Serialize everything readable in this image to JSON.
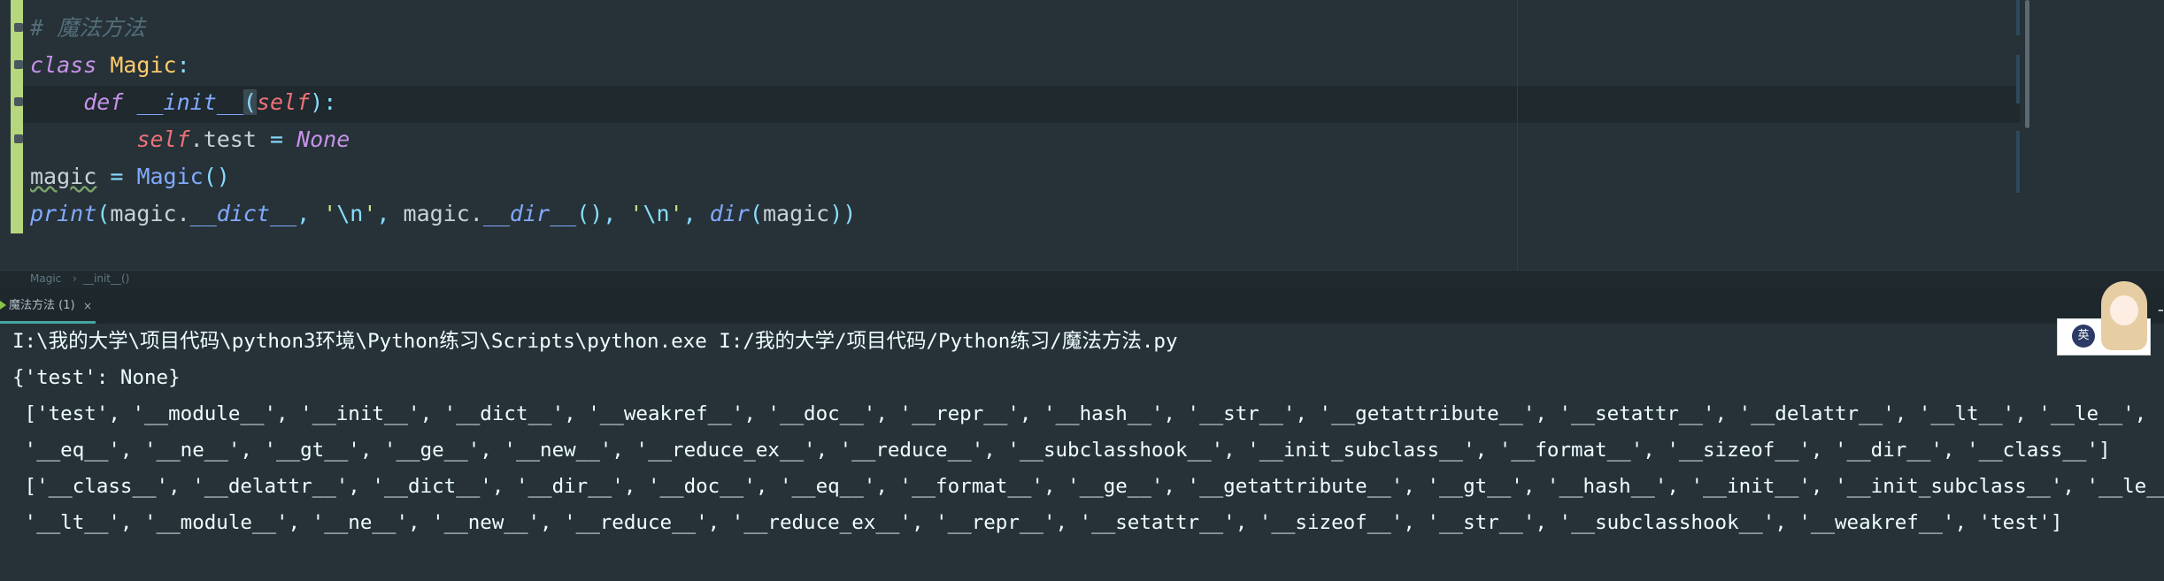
{
  "editor": {
    "lines": [
      {
        "tokens": [
          [
            "t-comment",
            "# 魔法方法"
          ]
        ]
      },
      {
        "tokens": [
          [
            "t-kw",
            "class"
          ],
          [
            "t-plain",
            " "
          ],
          [
            "t-cls",
            "Magic"
          ],
          [
            "t-punc",
            ":"
          ]
        ]
      },
      {
        "tokens": [
          [
            "t-plain",
            "    "
          ],
          [
            "t-kw",
            "def"
          ],
          [
            "t-plain",
            " "
          ],
          [
            "t-fn",
            "__init__"
          ],
          [
            "t-punc t-brace-hl",
            "("
          ],
          [
            "t-self",
            "self"
          ],
          [
            "t-punc",
            "):"
          ]
        ]
      },
      {
        "tokens": [
          [
            "t-plain",
            "        "
          ],
          [
            "t-self",
            "self"
          ],
          [
            "t-plain",
            ".test "
          ],
          [
            "t-op",
            "="
          ],
          [
            "t-plain",
            " "
          ],
          [
            "t-const",
            "None"
          ]
        ]
      },
      {
        "tokens": [
          [
            "t-plain t-underline",
            "magic"
          ],
          [
            "t-plain",
            " "
          ],
          [
            "t-op",
            "="
          ],
          [
            "t-plain",
            " "
          ],
          [
            "t-call",
            "Magic"
          ],
          [
            "t-punc",
            "()"
          ]
        ]
      },
      {
        "tokens": [
          [
            "t-fn",
            "print"
          ],
          [
            "t-punc",
            "("
          ],
          [
            "t-plain",
            "magic."
          ],
          [
            "t-fn",
            "__dict__"
          ],
          [
            "t-punc",
            ", "
          ],
          [
            "t-str",
            "'"
          ],
          [
            "t-esc",
            "\\n"
          ],
          [
            "t-str",
            "'"
          ],
          [
            "t-punc",
            ", "
          ],
          [
            "t-plain",
            "magic."
          ],
          [
            "t-fn",
            "__dir__"
          ],
          [
            "t-punc",
            "(), "
          ],
          [
            "t-str",
            "'"
          ],
          [
            "t-esc",
            "\\n"
          ],
          [
            "t-str",
            "'"
          ],
          [
            "t-punc",
            ", "
          ],
          [
            "t-fn",
            "dir"
          ],
          [
            "t-punc",
            "("
          ],
          [
            "t-plain",
            "magic"
          ],
          [
            "t-punc",
            "))"
          ]
        ]
      }
    ]
  },
  "breadcrumb": {
    "items": [
      "Magic",
      "›",
      "__init__()"
    ]
  },
  "run_panel": {
    "tab_label": "魔法方法 (1)",
    "close_glyph": "×",
    "edge_glyph": "-"
  },
  "console": {
    "lines": [
      "I:\\我的大学\\项目代码\\python3环境\\Python练习\\Scripts\\python.exe I:/我的大学/项目代码/Python练习/魔法方法.py",
      "{'test': None}",
      " ['test', '__module__', '__init__', '__dict__', '__weakref__', '__doc__', '__repr__', '__hash__', '__str__', '__getattribute__', '__setattr__', '__delattr__', '__lt__', '__le__',",
      " '__eq__', '__ne__', '__gt__', '__ge__', '__new__', '__reduce_ex__', '__reduce__', '__subclasshook__', '__init_subclass__', '__format__', '__sizeof__', '__dir__', '__class__']",
      " ['__class__', '__delattr__', '__dict__', '__dir__', '__doc__', '__eq__', '__format__', '__ge__', '__getattribute__', '__gt__', '__hash__', '__init__', '__init_subclass__', '__le__',",
      " '__lt__', '__module__', '__ne__', '__new__', '__reduce__', '__reduce_ex__', '__repr__', '__setattr__', '__sizeof__', '__str__', '__subclasshook__', '__weakref__', 'test']"
    ]
  },
  "mascot": {
    "badge_text": "英"
  },
  "colors": {
    "editor_bg": "#263238",
    "gutter_strip": "#b6d77e",
    "keyword": "#c792ea",
    "class_name": "#ffcb6b",
    "self": "#f07178",
    "function": "#82aaff",
    "string": "#c3e88d",
    "comment": "#546e7a",
    "console_text": "#eeffff",
    "tab_underline": "#44a5a0"
  }
}
